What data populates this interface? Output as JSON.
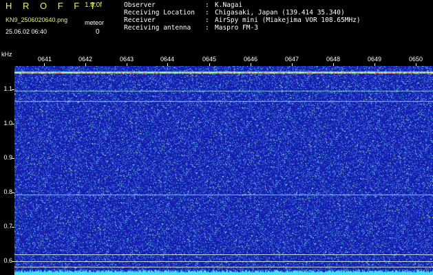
{
  "header": {
    "brand": "H R O F F T",
    "version": "1.0.0f",
    "filename": "KN9_2506020640.png",
    "timestamp": "25.06.02 06:40",
    "meteor_label": "meteor",
    "meteor_count": "0"
  },
  "meta": [
    {
      "key": "Observer",
      "value": "K.Nagai"
    },
    {
      "key": "Receiving Location",
      "value": "Chigasaki, Japan (139.414 35.340)"
    },
    {
      "key": "Receiver",
      "value": "AirSpy mini (Miakejima VOR 108.65MHz)"
    },
    {
      "key": "Receiving antenna",
      "value": "Maspro FM-3"
    }
  ],
  "axis": {
    "y_unit": "kHz",
    "y_ticks": [
      "1.1",
      "1.0",
      "0.9",
      "0.8",
      "0.7",
      "0.6"
    ],
    "x_ticks": [
      "0641",
      "0642",
      "0643",
      "0644",
      "0645",
      "0646",
      "0647",
      "0648",
      "0649",
      "0650"
    ]
  },
  "colors": {
    "background": "#1a2aa8",
    "accent": "#e8f07a",
    "line": "#c8d8ff"
  }
}
